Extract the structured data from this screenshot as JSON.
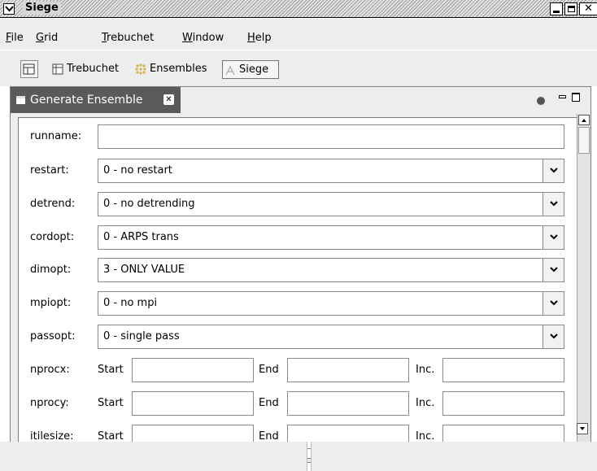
{
  "window": {
    "title": "Siege"
  },
  "menu": [
    "File",
    "Grid",
    "Trebuchet",
    "Window",
    "Help"
  ],
  "toolbar": {
    "items": [
      {
        "label": "Trebuchet"
      },
      {
        "label": "Ensembles"
      },
      {
        "label": "Siege",
        "active": true
      }
    ]
  },
  "view": {
    "tab_title": "Generate Ensemble",
    "close_glyph": "✕"
  },
  "form": {
    "runname": {
      "label": "runname:",
      "value": ""
    },
    "selects": [
      {
        "label": "restart:",
        "value": "0 - no restart"
      },
      {
        "label": "detrend:",
        "value": "0 - no detrending"
      },
      {
        "label": "cordopt:",
        "value": "0 - ARPS trans"
      },
      {
        "label": "dimopt:",
        "value": "3 - ONLY VALUE"
      },
      {
        "label": "mpiopt:",
        "value": "0 - no mpi"
      },
      {
        "label": "passopt:",
        "value": "0 - single pass"
      }
    ],
    "ranges": [
      {
        "label": "nprocx:",
        "start": "",
        "end": "",
        "inc": ""
      },
      {
        "label": "nprocy:",
        "start": "",
        "end": "",
        "inc": ""
      },
      {
        "label": "itilesize:",
        "start": "",
        "end": "",
        "inc": ""
      }
    ],
    "range_labels": {
      "start": "Start",
      "end": "End",
      "inc": "Inc."
    }
  },
  "colors": {
    "tab_bg": "#5a5a5a",
    "panel_bg": "#ededed"
  }
}
